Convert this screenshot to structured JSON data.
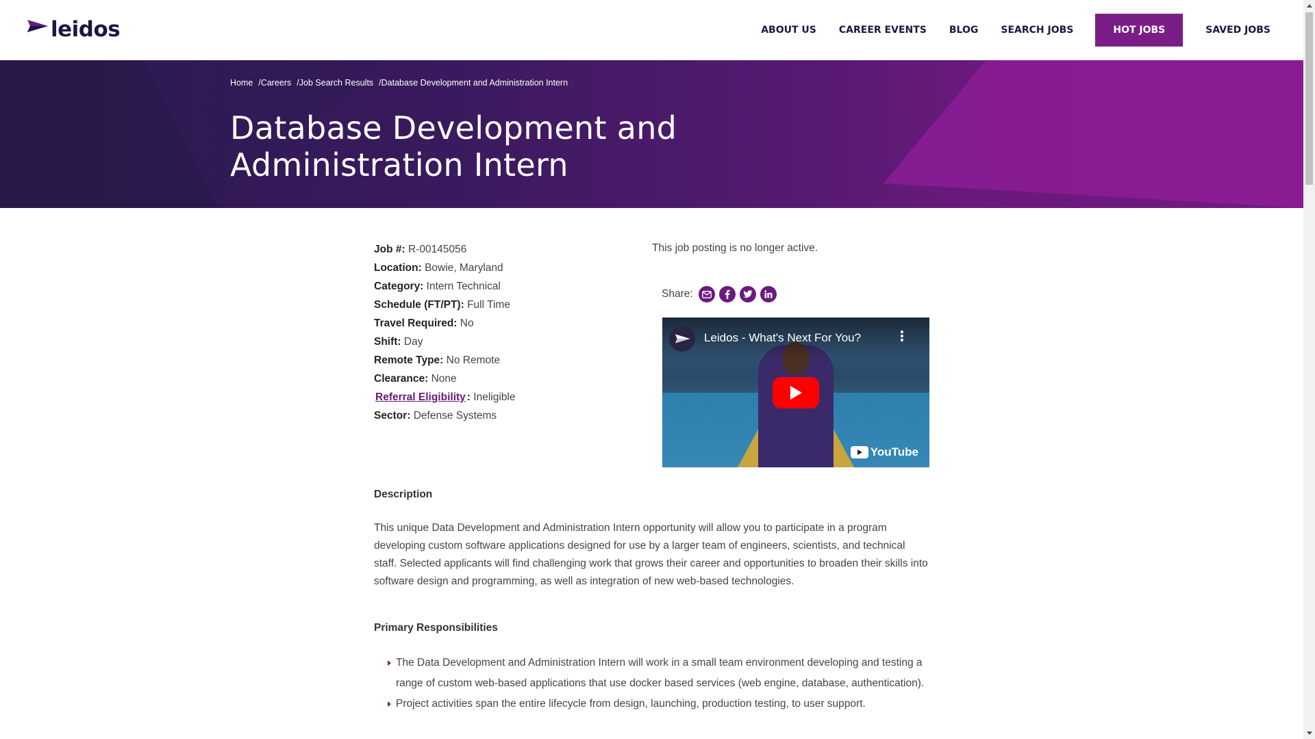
{
  "brand": {
    "logo_text": "leidos",
    "primary_color": "#7b1d86",
    "dark_color": "#1f1544"
  },
  "nav": {
    "items": [
      {
        "label": "ABOUT US"
      },
      {
        "label": "CAREER EVENTS"
      },
      {
        "label": "BLOG"
      },
      {
        "label": "SEARCH JOBS"
      },
      {
        "label": "HOT JOBS"
      },
      {
        "label": "SAVED JOBS"
      }
    ]
  },
  "breadcrumb": {
    "items": [
      "Home",
      "Careers",
      "Job Search Results",
      "Database Development and Administration Intern"
    ],
    "separator": "/"
  },
  "job": {
    "title": "Database Development and Administration Intern",
    "status": "This job posting is no longer active.",
    "meta": [
      {
        "label": "Job #:",
        "value": "R-00145056"
      },
      {
        "label": "Location:",
        "value": "Bowie, Maryland"
      },
      {
        "label": "Category:",
        "value": "Intern Technical"
      },
      {
        "label": "Schedule (FT/PT):",
        "value": "Full Time"
      },
      {
        "label": "Travel Required:",
        "value": "No"
      },
      {
        "label": "Shift:",
        "value": "Day"
      },
      {
        "label": "Remote Type:",
        "value": "No Remote"
      },
      {
        "label": "Clearance:",
        "value": "None"
      },
      {
        "label": "Referral Eligibility",
        "value": "Ineligible",
        "link": true
      },
      {
        "label": "Sector:",
        "value": "Defense Systems"
      }
    ]
  },
  "share": {
    "label": "Share:",
    "icons": [
      "email-icon",
      "facebook-icon",
      "twitter-icon",
      "linkedin-icon"
    ]
  },
  "video": {
    "title": "Leidos - What's Next For You?",
    "platform": "YouTube"
  },
  "description": {
    "heading": "Description",
    "paragraph": "This unique Data Development and Administration Intern opportunity will allow you to participate in a program developing custom software applications designed for use by a larger team of engineers, scientists, and technical staff. Selected applicants will find challenging work that grows their career and opportunities to broaden their skills into software design and programming, as well as integration of new web-based technologies."
  },
  "responsibilities": {
    "heading": "Primary Responsibilities",
    "items": [
      "The Data Development and Administration Intern will work in a small team environment developing and testing a range of custom web-based applications that use docker based services (web engine, database, authentication).",
      "Project activities span the entire lifecycle from design, launching, production testing, to user support."
    ]
  }
}
